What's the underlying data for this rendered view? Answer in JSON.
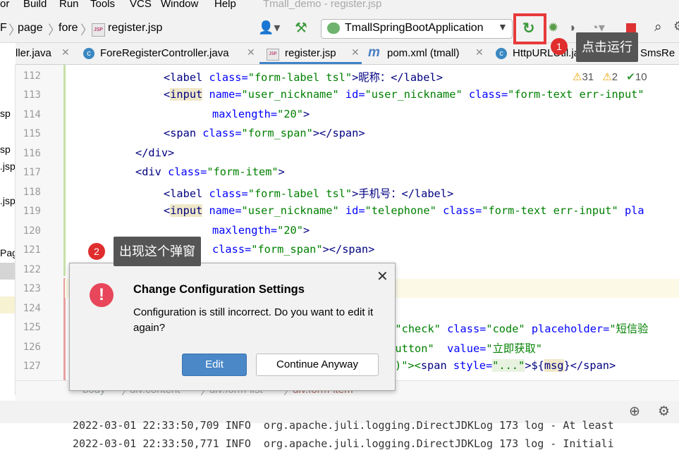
{
  "menu": {
    "items": [
      "or",
      "Build",
      "Run",
      "Tools",
      "VCS",
      "Window",
      "Help"
    ],
    "window_title": "Tmall_demo - register.jsp"
  },
  "nav": {
    "crumbs": [
      "F",
      "page",
      "fore",
      "register.jsp"
    ],
    "run_config": "TmallSpringBootApplication"
  },
  "tabs": [
    {
      "label": "ller.java"
    },
    {
      "label": "ForeRegisterController.java"
    },
    {
      "label": "register.jsp"
    },
    {
      "label": "pom.xml (tmall)"
    },
    {
      "label": "HttpURLUtil.java"
    },
    {
      "label": "SmsRe"
    }
  ],
  "project_panel": [
    "sp",
    "sp",
    ".jsp",
    ".jsp",
    "Pag"
  ],
  "inspections": {
    "warnings": "31",
    "weak_warnings": "2",
    "ok": "10"
  },
  "lines": [
    "112",
    "113",
    "114",
    "115",
    "116",
    "117",
    "118",
    "119",
    "120",
    "121",
    "122",
    "123",
    "124",
    "125",
    "126",
    "127"
  ],
  "code": {
    "l112": {
      "a": "<label ",
      "b": "class=",
      "c": "\"form-label tsl\"",
      "d": ">昵称：</",
      "e": "label",
      "f": ">"
    },
    "l113": {
      "a": "<",
      "b": "input",
      "c": " name=",
      "d": "\"user_nickname\"",
      "e": " id=",
      "f": "\"user_nickname\"",
      "g": " class=",
      "h": "\"form-text err-input\""
    },
    "l114": {
      "a": "maxlength=",
      "b": "\"20\"",
      "c": ">"
    },
    "l115": {
      "a": "<span ",
      "b": "class=",
      "c": "\"form_span\"",
      "d": "></",
      "e": "span",
      "f": ">"
    },
    "l116": {
      "a": "</div>"
    },
    "l117": {
      "a": "<div ",
      "b": "class=",
      "c": "\"form-item\"",
      "d": ">"
    },
    "l118": {
      "a": "<label ",
      "b": "class=",
      "c": "\"form-label tsl\"",
      "d": ">手机号：</",
      "e": "label",
      "f": ">"
    },
    "l119": {
      "a": "<",
      "b": "input",
      "c": " name=",
      "d": "\"user_nickname\"",
      "e": " id=",
      "f": "\"telephone\"",
      "g": " class=",
      "h": "\"form-text err-input\"",
      "i": " pla"
    },
    "l120": {
      "a": "maxlength=",
      "b": "\"20\"",
      "c": ">"
    },
    "l121": {
      "a": "class=",
      "b": "\"form_span\"",
      "c": "></",
      "d": "span",
      "e": ">"
    },
    "l125": {
      "a": "e=",
      "b": "\"check\"",
      "c": " class=",
      "d": "\"code\"",
      "e": " placeholder=",
      "f": "\"短信验"
    },
    "l126": {
      "a": "eButton\"",
      "b": "  value=",
      "c": "\"立即获取\""
    },
    "l127": {
      "a": ")\"><",
      "b": "span ",
      "c": "style=",
      "d": "\"...\"",
      "e": ">${",
      "f": "msg",
      "g": "}</",
      "h": "span",
      "i": ">"
    }
  },
  "structure_breadcrumb": [
    "body",
    "div.content",
    "div.form-list",
    "div.form-item"
  ],
  "log": {
    "line1": "2022-03-01 22:33:50,709 INFO  org.apache.juli.logging.DirectJDKLog 173 log - At least",
    "line2": "2022-03-01 22:33:50,771 INFO  org.apache.juli.logging.DirectJDKLog 173 log - Initiali"
  },
  "dialog": {
    "title": "Change Configuration Settings",
    "message": "Configuration is still incorrect. Do you want to edit it again?",
    "edit_label": "Edit",
    "continue_label": "Continue Anyway",
    "close_glyph": "✕"
  },
  "annotations": {
    "step1": {
      "num": "1",
      "text": "点击运行"
    },
    "step2": {
      "num": "2",
      "text": "出现这个弹窗"
    }
  },
  "icons": {
    "error": "error-circle-icon",
    "run": "rerun-icon",
    "build": "hammer-icon"
  },
  "colors": {
    "accent": "#4a88c7",
    "annotation_red": "#e02d2d",
    "error": "#e0413b"
  }
}
